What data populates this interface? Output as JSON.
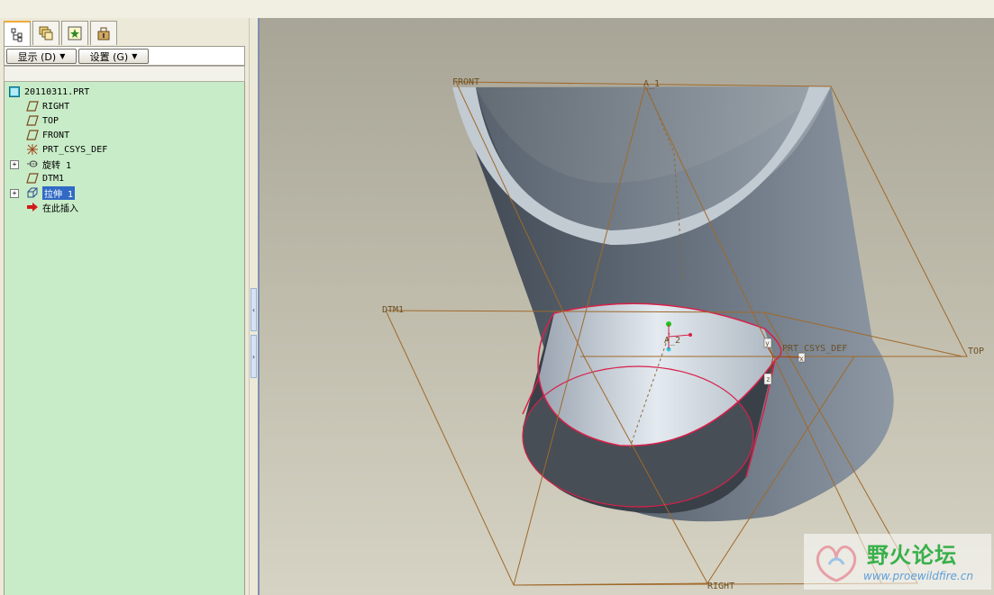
{
  "left_panel": {
    "tabs": [
      {
        "icon": "model-tree-icon",
        "active": true
      },
      {
        "icon": "layers-icon",
        "active": false
      },
      {
        "icon": "favorites-icon",
        "active": false
      },
      {
        "icon": "tools-icon",
        "active": false
      }
    ],
    "toolbar": {
      "show_label": "显示 (D)",
      "settings_label": "设置 (G)"
    },
    "tree": {
      "root": "20110311.PRT",
      "items": [
        {
          "label": "RIGHT",
          "icon": "datum-plane-icon"
        },
        {
          "label": "TOP",
          "icon": "datum-plane-icon"
        },
        {
          "label": "FRONT",
          "icon": "datum-plane-icon"
        },
        {
          "label": "PRT_CSYS_DEF",
          "icon": "csys-icon"
        },
        {
          "label": "旋转 1",
          "icon": "revolve-icon"
        },
        {
          "label": "DTM1",
          "icon": "datum-plane-icon"
        },
        {
          "label": "拉伸 1",
          "icon": "extrude-icon"
        },
        {
          "label": "在此插入",
          "icon": "insert-arrow-icon"
        }
      ]
    }
  },
  "viewport": {
    "labels": {
      "front": "FRONT",
      "a1": "A_1",
      "dtm1": "DTM1",
      "a2": "A_2",
      "csys": "PRT_CSYS_DEF",
      "top": "TOP",
      "right": "RIGHT",
      "x": "x",
      "y": "y",
      "z": "z"
    }
  },
  "watermark": {
    "title": "野火论坛",
    "url": "www.proewildfire.cn"
  },
  "colors": {
    "tree_bg": "#c8ecc8",
    "selection": "#316ac5",
    "datum": "#a0692a",
    "edge_highlight": "#d8204a"
  }
}
